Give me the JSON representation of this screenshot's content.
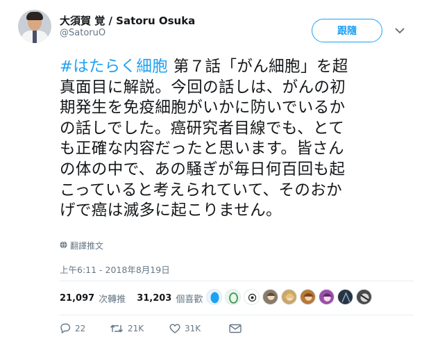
{
  "author": {
    "name": "大須賀 覚 / Satoru Osuka",
    "handle": "@SatoruO"
  },
  "follow_button": {
    "label": "跟隨"
  },
  "tweet": {
    "hashtag": "#はたらく細胞",
    "lines": [
      " 第７話「がん細胞」を超",
      "真面目に解説。今回の話しは、がんの初",
      "期発生を免疫細胞がいかに防いでいるか",
      "の話しでした。癌研究者目線でも、とて",
      "も正確な内容だったと思います。皆さん",
      "の体の中で、あの騒ぎが毎日何百回も起",
      "こっていると考えられていて、そのおか",
      "げで癌は滅多に起こりません。"
    ],
    "translate_label": "翻譯推文",
    "timestamp": "上午6:11 - 2018年8月19日"
  },
  "stats": {
    "retweets_count": "21,097",
    "retweets_label": "次轉推",
    "likes_count": "31,203",
    "likes_label": "個喜歡"
  },
  "likers": [
    {
      "icon": "blue-circle-avatar",
      "color": "#1da1f2"
    },
    {
      "icon": "green-egg-avatar",
      "color": "#4a9e5c"
    },
    {
      "icon": "eye-avatar",
      "color": "#222222"
    },
    {
      "icon": "anime-avatar-1",
      "color": "#8a7c6a"
    },
    {
      "icon": "anime-avatar-2",
      "color": "#c9a86a"
    },
    {
      "icon": "anime-avatar-3",
      "color": "#b87a3a"
    },
    {
      "icon": "anime-avatar-4",
      "color": "#9b4fa8"
    },
    {
      "icon": "dark-avatar-1",
      "color": "#2b3340"
    },
    {
      "icon": "dark-avatar-2",
      "color": "#4a4a4a"
    }
  ],
  "actions": {
    "reply_count": "22",
    "retweet_count": "21K",
    "like_count": "31K"
  },
  "colors": {
    "accent": "#1da1f2",
    "muted": "#657786",
    "text": "#14171a",
    "divider": "#e6ecf0"
  }
}
